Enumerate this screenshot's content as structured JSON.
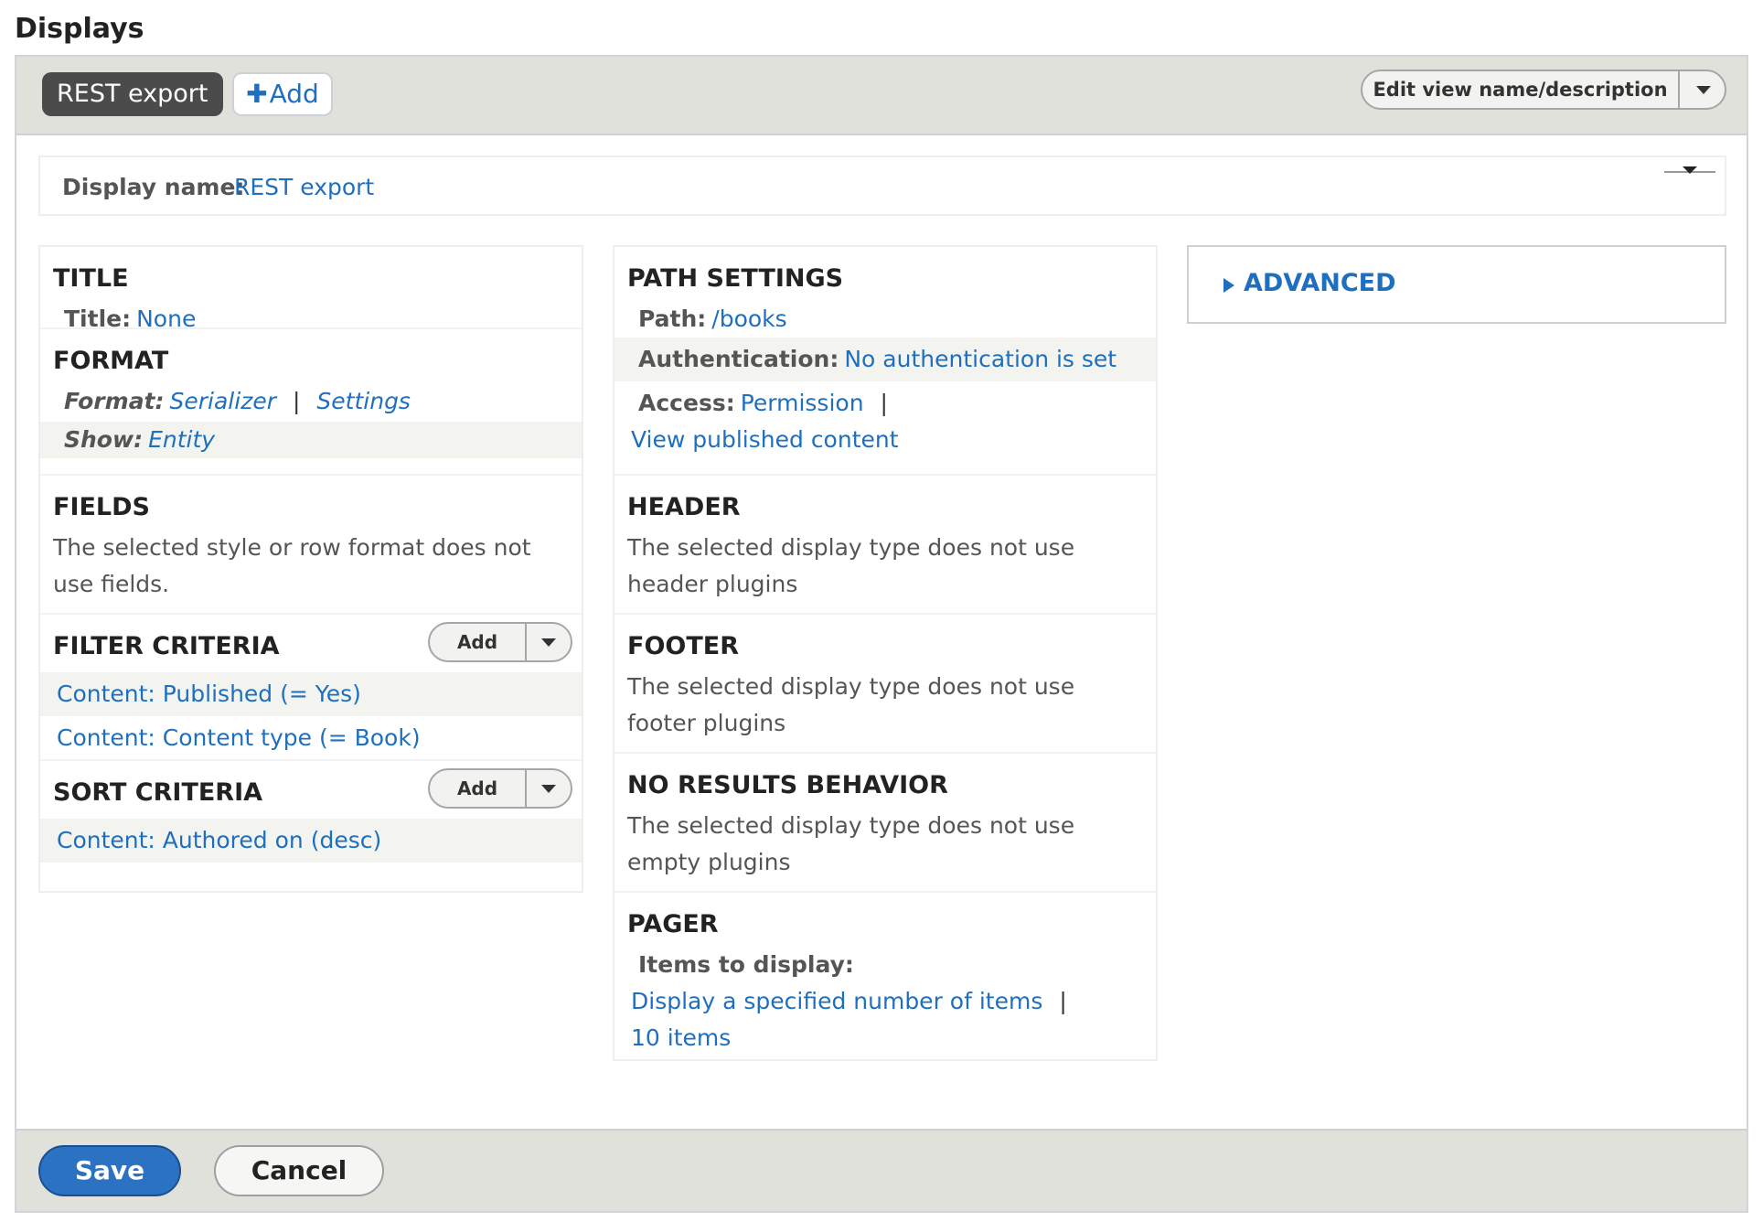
{
  "page_title": "Displays",
  "tabs": {
    "active": "REST export",
    "add": "Add"
  },
  "edit_view": {
    "label": "Edit view name/description"
  },
  "display_name": {
    "label": "Display name:",
    "value": "REST export"
  },
  "col1": {
    "title": {
      "heading": "TITLE",
      "label": "Title:",
      "value": "None"
    },
    "format": {
      "heading": "FORMAT",
      "format_label": "Format:",
      "format_value": "Serializer",
      "separator": "|",
      "settings": "Settings",
      "show_label": "Show:",
      "show_value": "Entity"
    },
    "fields": {
      "heading": "FIELDS",
      "text": "The selected style or row format does not use fields."
    },
    "filter": {
      "heading": "FILTER CRITERIA",
      "add": "Add",
      "items": [
        "Content: Published (= Yes)",
        "Content: Content type (= Book)"
      ]
    },
    "sort": {
      "heading": "SORT CRITERIA",
      "add": "Add",
      "items": [
        "Content: Authored on (desc)"
      ]
    }
  },
  "col2": {
    "path": {
      "heading": "PATH SETTINGS",
      "path_label": "Path:",
      "path_value": "/books",
      "auth_label": "Authentication:",
      "auth_value": "No authentication is set",
      "access_label": "Access:",
      "access_value": "Permission",
      "separator": "|",
      "access_extra": "View published content"
    },
    "header": {
      "heading": "HEADER",
      "text": "The selected display type does not use header plugins"
    },
    "footer": {
      "heading": "FOOTER",
      "text": "The selected display type does not use footer plugins"
    },
    "noresults": {
      "heading": "NO RESULTS BEHAVIOR",
      "text": "The selected display type does not use empty plugins"
    },
    "pager": {
      "heading": "PAGER",
      "label": "Items to display:",
      "value": "Display a specified number of items",
      "separator": "|",
      "count": "10 items"
    }
  },
  "advanced": {
    "label": "ADVANCED"
  },
  "actions": {
    "save": "Save",
    "cancel": "Cancel"
  },
  "colors": {
    "link": "#1f6fbf",
    "save": "#2b73c2",
    "bar": "#e1e1dc",
    "active_tab": "#4b4b4b"
  }
}
